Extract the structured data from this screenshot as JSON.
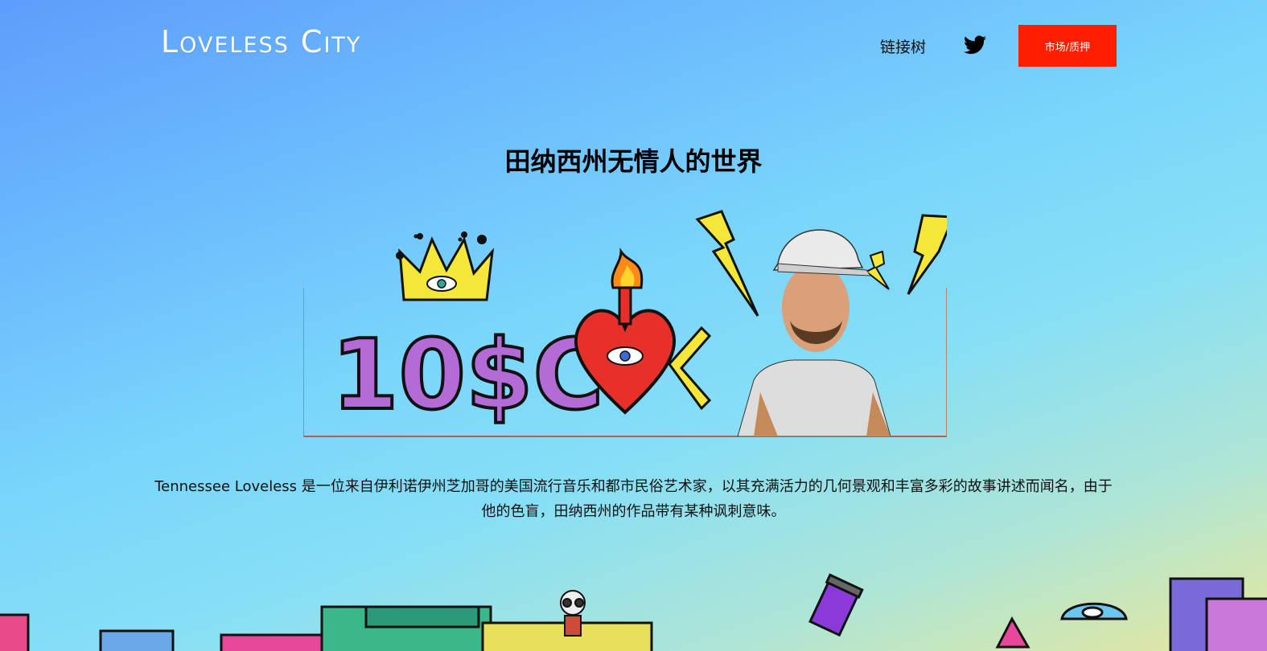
{
  "header": {
    "logo": "Loveless City",
    "nav_link": "链接树",
    "twitter_icon": "twitter-icon",
    "market_button": "市场/质押"
  },
  "main": {
    "title": "田纳西州无情人的世界",
    "banner_text": "10$C",
    "description": "Tennessee Loveless 是一位来自伊利诺伊州芝加哥的美国流行音乐和都市民俗艺术家，以其充满活力的几何景观和丰富多彩的故事讲述而闻名，由于他的色盲，田纳西州的作品带有某种讽刺意味。"
  },
  "colors": {
    "accent": "#ff1f00",
    "bg_top": "#5e9dfb",
    "bg_bottom": "#e7e79c"
  }
}
